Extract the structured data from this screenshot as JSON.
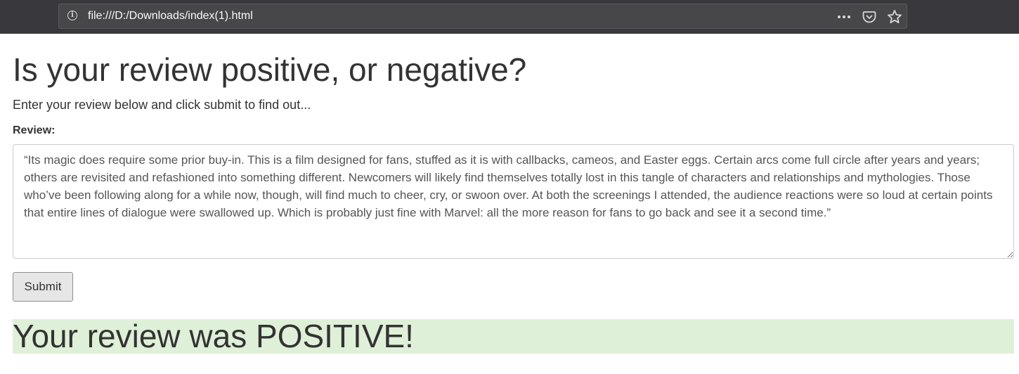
{
  "browser": {
    "url": "file:///D:/Downloads/index(1).html",
    "icons": [
      "info-icon",
      "more-icon",
      "pocket-icon",
      "bookmark-star-icon"
    ]
  },
  "page": {
    "title": "Is your review positive, or negative?",
    "subtitle": "Enter your review below and click submit to find out...",
    "review_label": "Review:",
    "review_text": "“Its magic does require some prior buy-in. This is a film designed for fans, stuffed as it is with callbacks, cameos, and Easter eggs. Certain arcs come full circle after years and years; others are revisited and refashioned into something different. Newcomers will likely find themselves totally lost in this tangle of characters and relationships and mythologies. Those who’ve been following along for a while now, though, will find much to cheer, cry, or swoon over. At both the screenings I attended, the audience reactions were so loud at certain points that entire lines of dialogue were swallowed up. Which is probably just fine with Marvel: all the more reason for fans to go back and see it a second time.”",
    "submit_label": "Submit",
    "result": "Your review was POSITIVE!"
  },
  "colors": {
    "result_background": "#dff0d8",
    "browser_toolbar": "#38383d"
  }
}
